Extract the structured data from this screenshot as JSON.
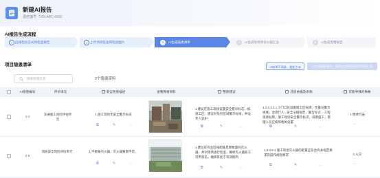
{
  "header": {
    "title": "新建AI报告",
    "report_no_label": "报告编号",
    "report_no_value": "TXJLABC-0002"
  },
  "process": {
    "title": "AI报告生成流程",
    "steps": [
      {
        "num": "1",
        "label": "选择检验方式和检查报告",
        "status": "done"
      },
      {
        "num": "2",
        "label": "上传项目检查和检验图片",
        "status": "done"
      },
      {
        "num": "3",
        "label": "AI生成隐患清单",
        "status": "active"
      },
      {
        "num": "4",
        "label": "AI生成现场评价分级汇总",
        "status": "todo"
      },
      {
        "num": "5",
        "label": "AI生成完整报告",
        "status": "todo"
      }
    ]
  },
  "hazard_list": {
    "title": "项目隐患清单",
    "search_placeholder": "搜索隐患信息",
    "count_text": "2个隐患资料",
    "buttons": {
      "regenerate": "AI结果不满意，重新生成",
      "next": "以生成隐患清单，现在去生成现场评价分级汇总"
    },
    "columns": {
      "code": "AI隐患编号",
      "unit": "评价单元",
      "desc": "安全隐患描述",
      "photo": "查看教材资料",
      "suggest": "整改建议",
      "basis": "违反依据及条款",
      "consequence": "可能导致的事故"
    },
    "rows": [
      {
        "code": "1-1",
        "unit": "交通施工风险评估单元",
        "desc": "1.施工现场无安全警示标志",
        "suggest": "1.建议在施工现场设置安全警示标志，如施工区、建议对危险区域警示标线，并设专人监护",
        "basis": "1.3.2.4.2.1 ②门口应设置施工区标牌，至置与警示视线，注意行人...安全法规规范，警告标识... 工程现场标牌，施工现场安全警示标识，说明施工，管理人员应按照相关设置",
        "consequence": "1.物体打击"
      },
      {
        "code": "1-2",
        "unit": "消防安全风险评估单元",
        "desc": "1.不配备灭火器，灭火器数量不足。",
        "suggest": "1.建议在作业区域配备足够数量的灭火器，并对现场进行检查，确保灭火器处于可用状态，确保其处于有效期内",
        "basis": "1.2.3.6.4 施工现场灭火器的配置应符合有关规范要求及操作规程要求",
        "consequence": "1.火灾"
      }
    ]
  }
}
